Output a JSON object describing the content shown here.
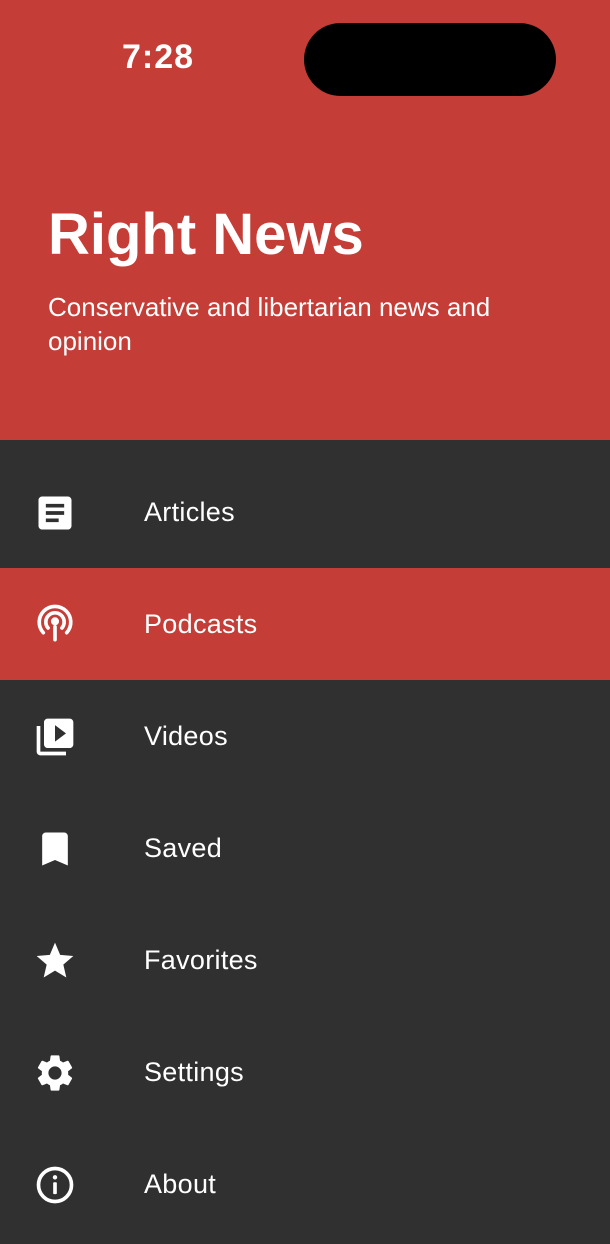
{
  "status_bar": {
    "time": "7:28"
  },
  "header": {
    "title": "Right News",
    "subtitle": "Conservative and libertarian news and opinion",
    "background_color": "#C43D37"
  },
  "menu": {
    "active_color": "#C43D37",
    "background_color": "#303030",
    "items": [
      {
        "label": "Articles",
        "icon": "article-icon",
        "active": false
      },
      {
        "label": "Podcasts",
        "icon": "podcast-icon",
        "active": true
      },
      {
        "label": "Videos",
        "icon": "video-library-icon",
        "active": false
      },
      {
        "label": "Saved",
        "icon": "bookmark-icon",
        "active": false
      },
      {
        "label": "Favorites",
        "icon": "star-icon",
        "active": false
      },
      {
        "label": "Settings",
        "icon": "gear-icon",
        "active": false
      },
      {
        "label": "About",
        "icon": "info-icon",
        "active": false
      }
    ]
  }
}
